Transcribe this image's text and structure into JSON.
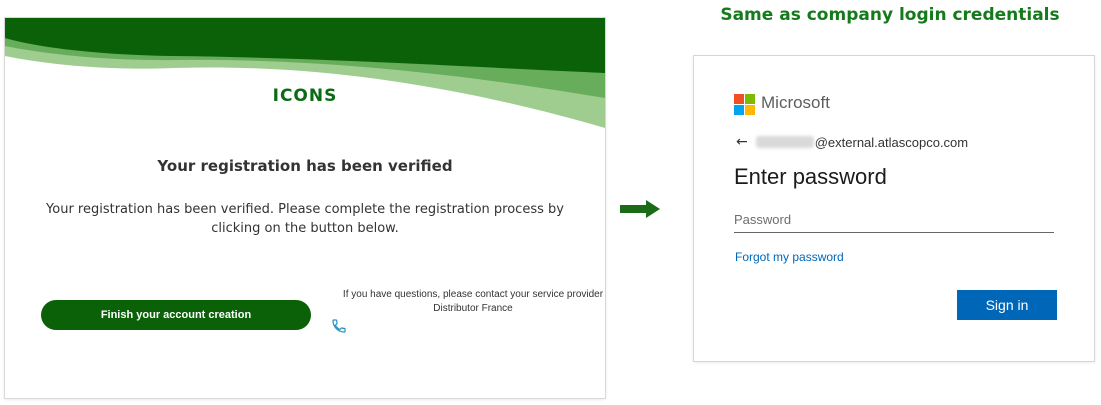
{
  "left_panel": {
    "logo_text": "ICONS",
    "title": "Your registration has been verified",
    "body": "Your registration has been verified. Please complete the registration process by clicking on the button below.",
    "finish_button": "Finish your account creation",
    "contact_line1": "If you have questions, please contact your service provider",
    "contact_line2": "Distributor France"
  },
  "arrow": {
    "icon": "right-arrow-icon",
    "color": "#1a6b17"
  },
  "headline": "Same as company login credentials",
  "right_panel": {
    "brand": "Microsoft",
    "email_domain": "@external.atlascopco.com",
    "heading": "Enter password",
    "password_placeholder": "Password",
    "forgot_link": "Forgot my password",
    "signin_button": "Sign in"
  },
  "colors": {
    "brand_green": "#0b6108",
    "headline_green": "#157a1b",
    "ms_blue": "#0067b8",
    "ms_logo": [
      "#f25022",
      "#7fba00",
      "#00a4ef",
      "#ffb900"
    ]
  }
}
